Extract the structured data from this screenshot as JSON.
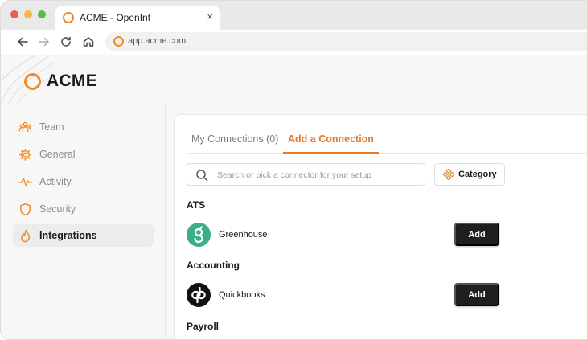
{
  "browser": {
    "tab_title": "ACME - OpenInt",
    "tab_close": "×",
    "url": "app.acme.com"
  },
  "brand": {
    "name": "ACME",
    "accent": "#f08a24"
  },
  "sidebar": {
    "items": [
      {
        "label": "Team",
        "icon": "team-icon"
      },
      {
        "label": "General",
        "icon": "gear-icon"
      },
      {
        "label": "Activity",
        "icon": "activity-icon"
      },
      {
        "label": "Security",
        "icon": "shield-icon"
      },
      {
        "label": "Integrations",
        "icon": "flame-icon",
        "active": true
      }
    ]
  },
  "main": {
    "tabs": [
      {
        "label": "My Connections (0)"
      },
      {
        "label": "Add a Connection",
        "active": true
      }
    ],
    "search_placeholder": "Search or pick a connector for your setup",
    "category_label": "Category",
    "sections": [
      {
        "title": "ATS",
        "connectors": [
          {
            "name": "Greenhouse",
            "logo_color": "#3ab087",
            "logo_glyph": "g",
            "button": "Add"
          }
        ]
      },
      {
        "title": "Accounting",
        "connectors": [
          {
            "name": "Quickbooks",
            "logo_color": "#111111",
            "logo_glyph": "qb",
            "button": "Add"
          }
        ]
      },
      {
        "title": "Payroll",
        "connectors": []
      }
    ]
  }
}
